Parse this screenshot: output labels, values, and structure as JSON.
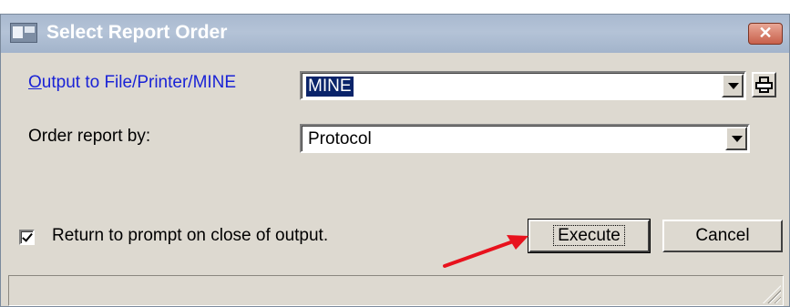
{
  "window": {
    "title": "Select Report Order",
    "close_label": "✕"
  },
  "output": {
    "label_mnemonic": "O",
    "label_rest": "utput to File/Printer/MINE",
    "value": "MINE"
  },
  "order": {
    "label": "Order report by:",
    "value": "Protocol"
  },
  "return_prompt": {
    "label": "Return to prompt on close of output.",
    "checked": true
  },
  "buttons": {
    "execute": "Execute",
    "cancel": "Cancel"
  },
  "annotation": {
    "arrow_color": "#e8121d"
  },
  "colors": {
    "dialog_bg": "#ddd9d0",
    "title_bar": "#b4c3d7",
    "link": "#1a23d6",
    "selection": "#0a246a"
  }
}
